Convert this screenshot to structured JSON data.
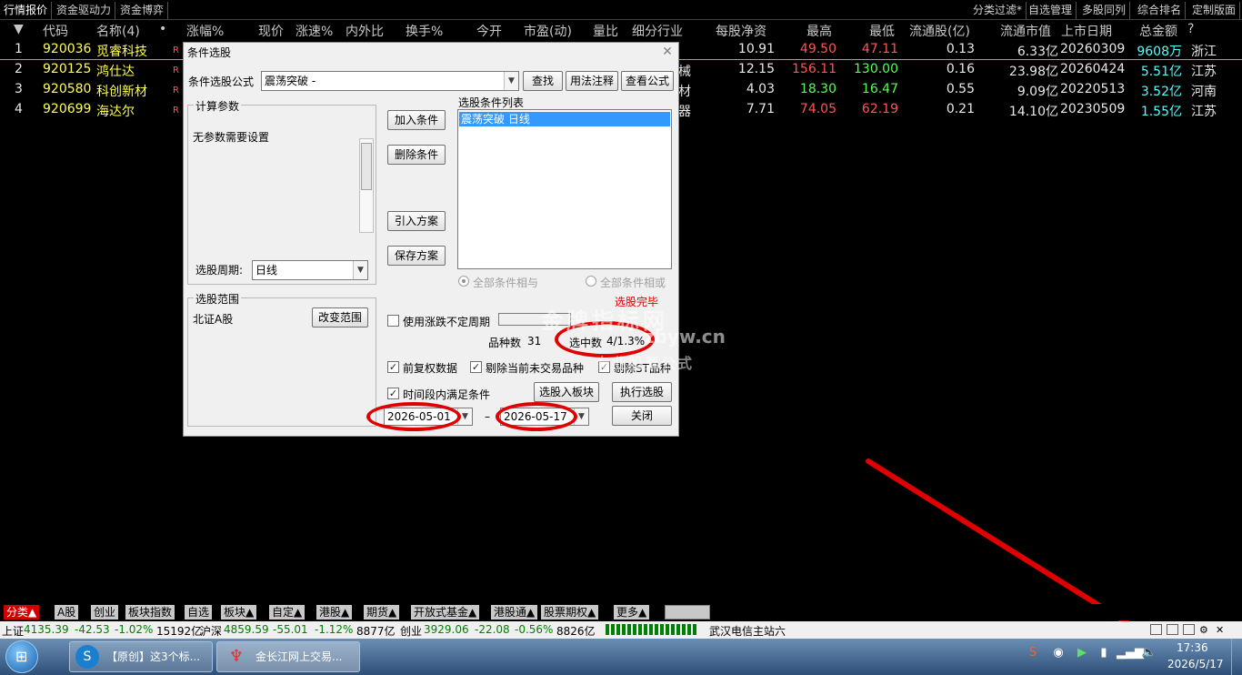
{
  "top_tabs": [
    "行情报价",
    "资金驱动力",
    "资金博弈"
  ],
  "top_right_tabs": [
    "分类过滤*",
    "自选管理",
    "多股同列",
    "综合排名",
    "定制版面"
  ],
  "columns": [
    "代码",
    "名称(4)",
    "•",
    "涨幅%",
    "现价",
    "涨速%",
    "内外比",
    "换手%",
    "今开",
    "市盈(动)",
    "量比",
    "细分行业",
    "每股净资",
    "最高",
    "最低",
    "流通股(亿)",
    "流通市值",
    "上市日期",
    "总金额",
    "?"
  ],
  "sort_marker": "▼",
  "rows": [
    {
      "idx": "1",
      "code": "920036",
      "name": "觅睿科技",
      "flag": "R",
      "industry": "",
      "nav": "10.91",
      "high": "49.50",
      "low": "47.11",
      "float_shares": "0.13",
      "float_cap": "6.33亿",
      "list_date": "20260309",
      "amount": "9608万",
      "region": "浙江"
    },
    {
      "idx": "2",
      "code": "920125",
      "name": "鸿仕达",
      "flag": "R",
      "industry": "械",
      "nav": "12.15",
      "high": "156.11",
      "low": "130.00",
      "float_shares": "0.16",
      "float_cap": "23.98亿",
      "list_date": "20260424",
      "amount": "5.51亿",
      "region": "江苏"
    },
    {
      "idx": "3",
      "code": "920580",
      "name": "科创新材",
      "flag": "R",
      "industry": "材",
      "nav": "4.03",
      "high": "18.30",
      "low": "16.47",
      "float_shares": "0.55",
      "float_cap": "9.09亿",
      "list_date": "20220513",
      "amount": "3.52亿",
      "region": "河南"
    },
    {
      "idx": "4",
      "code": "920699",
      "name": "海达尔",
      "flag": "R",
      "industry": "器",
      "nav": "7.71",
      "high": "74.05",
      "low": "62.19",
      "float_shares": "0.21",
      "float_cap": "14.10亿",
      "list_date": "20230509",
      "amount": "1.55亿",
      "region": "江苏"
    }
  ],
  "dialog": {
    "title": "条件选股",
    "close": "✕",
    "formula_label": "条件选股公式",
    "formula_value": "震荡突破  -",
    "btn_find": "查找",
    "btn_usage": "用法注释",
    "btn_view": "查看公式",
    "params_title": "计算参数",
    "params_text": "无参数需要设置",
    "period_label": "选股周期:",
    "period_value": "日线",
    "btn_add": "加入条件",
    "btn_delete": "删除条件",
    "btn_import": "引入方案",
    "btn_save": "保存方案",
    "cond_list_title": "选股条件列表",
    "cond_item": "震荡突破  日线",
    "radio_and": "全部条件相与",
    "radio_or": "全部条件相或",
    "range_title": "选股范围",
    "range_value": "北证A股",
    "btn_change_range": "改变范围",
    "done_text": "选股完毕",
    "use_period_label": "使用涨跌不定周期",
    "count_label": "品种数",
    "count_value": "31",
    "selected_label": "选中数",
    "selected_value": "4/1.3%",
    "chk_adjust": "前复权数据",
    "chk_exclude_suspend": "剔除当前未交易品种",
    "chk_exclude_st": "剔除ST品种",
    "chk_time_range": "时间段内满足条件",
    "btn_to_block": "选股入板块",
    "btn_execute": "执行选股",
    "date_from": "2026-05-01",
    "date_sep": "–",
    "date_to": "2026-05-17",
    "btn_close": "关闭"
  },
  "watermark": {
    "line1": "金牌指标网",
    "line2": "zbyw.cn",
    "line3": "专业股票公式"
  },
  "bottom_tabs": [
    "分类▲",
    "A股",
    "创业",
    "板块指数",
    "自选",
    "板块▲",
    "自定▲",
    "港股▲",
    "期货▲",
    "开放式基金▲",
    "港股通▲",
    "股票期权▲",
    "更多▲"
  ],
  "status": {
    "sh_label": "上证",
    "sh_value": "4135.39",
    "sh_change": "-42.53",
    "sh_pct": "-1.02%",
    "sh_amount": "15192亿",
    "hs_label": "沪深",
    "hs_value": "4859.59",
    "hs_change": "-55.01",
    "hs_pct": "-1.12%",
    "hs_amount": "8877亿",
    "cy_label": "创业",
    "cy_value": "3929.06",
    "cy_change": "-22.08",
    "cy_pct": "-0.56%",
    "cy_amount": "8826亿",
    "server": "武汉电信主站六"
  },
  "taskbar": {
    "item1": "【原创】这3个标...",
    "item2": "金长江网上交易...",
    "time": "17:36",
    "date": "2026/5/17"
  }
}
